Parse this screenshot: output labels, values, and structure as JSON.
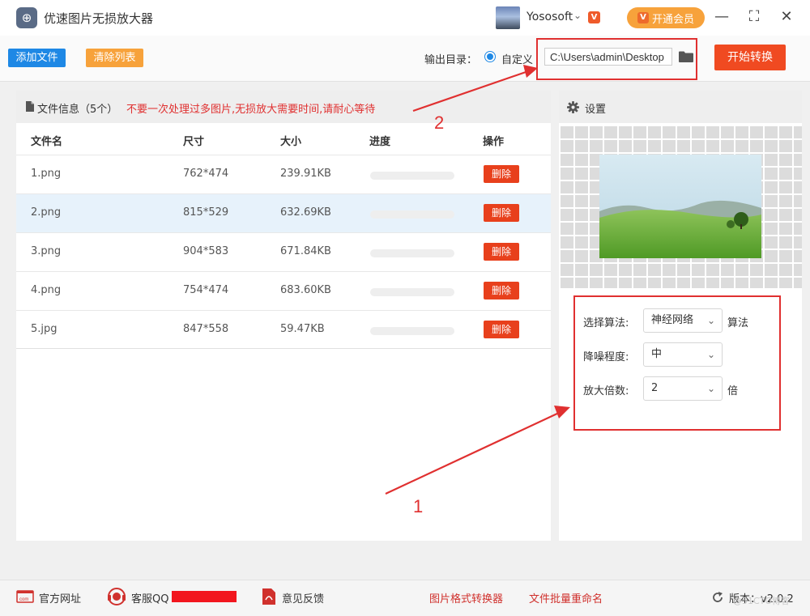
{
  "app": {
    "title": "优速图片无损放大器"
  },
  "user": {
    "name": "Yososoft",
    "caret": "⌄",
    "vip_label": "开通会员",
    "vip_badge": "V"
  },
  "window": {
    "minimize": "—",
    "maximize": "⛶",
    "close": "✕"
  },
  "toolbar": {
    "add_file": "添加文件",
    "clear_list": "清除列表",
    "output_label": "输出目录：",
    "radio_custom": "自定义",
    "output_path": "C:\\Users\\admin\\Desktop",
    "start": "开始转换"
  },
  "file_panel": {
    "title": "文件信息（5个）",
    "warning": "不要一次处理过多图片,无损放大需要时间,请耐心等待",
    "columns": [
      "文件名",
      "尺寸",
      "大小",
      "进度",
      "操作"
    ],
    "rows": [
      {
        "name": "1.png",
        "size": "762*474",
        "bytes": "239.91KB",
        "progress": 0,
        "action": "删除"
      },
      {
        "name": "2.png",
        "size": "815*529",
        "bytes": "632.69KB",
        "progress": 0,
        "action": "删除"
      },
      {
        "name": "3.png",
        "size": "904*583",
        "bytes": "671.84KB",
        "progress": 0,
        "action": "删除"
      },
      {
        "name": "4.png",
        "size": "754*474",
        "bytes": "683.60KB",
        "progress": 0,
        "action": "删除"
      },
      {
        "name": "5.jpg",
        "size": "847*558",
        "bytes": "59.47KB",
        "progress": 0,
        "action": "删除"
      }
    ]
  },
  "settings": {
    "title": "设置",
    "algorithm_label": "选择算法:",
    "algorithm_value": "神经网络",
    "algorithm_suffix": "算法",
    "denoise_label": "降噪程度:",
    "denoise_value": "中",
    "scale_label": "放大倍数:",
    "scale_value": "2",
    "scale_suffix": "倍"
  },
  "annotations": {
    "marker_1": "1",
    "marker_2": "2"
  },
  "footer": {
    "website": "官方网址",
    "qq": "客服QQ",
    "feedback": "意见反馈",
    "converter": "图片格式转换器",
    "renamer": "文件批量重命名",
    "version": "版本：v2.0.2"
  },
  "watermark": "@51CTO博客",
  "colors": {
    "primary_blue": "#1e88e5",
    "orange": "#f7a23b",
    "red": "#f04a21",
    "annotation_red": "#e03030"
  }
}
